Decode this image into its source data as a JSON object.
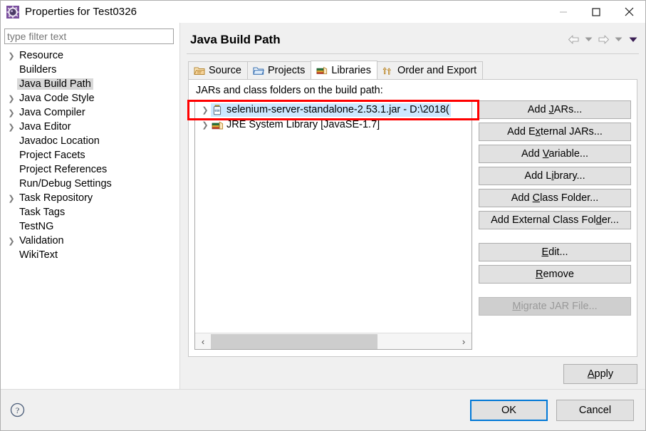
{
  "window": {
    "title": "Properties for Test0326",
    "icon": "properties-gear-icon",
    "minimize_label": "—",
    "maximize_label": "□",
    "close_label": "✕"
  },
  "sidebar": {
    "filter": {
      "value": "",
      "placeholder": "type filter text"
    },
    "items": [
      {
        "label": "Resource",
        "expandable": true,
        "selected": false
      },
      {
        "label": "Builders",
        "expandable": false,
        "selected": false
      },
      {
        "label": "Java Build Path",
        "expandable": false,
        "selected": true
      },
      {
        "label": "Java Code Style",
        "expandable": true,
        "selected": false
      },
      {
        "label": "Java Compiler",
        "expandable": true,
        "selected": false
      },
      {
        "label": "Java Editor",
        "expandable": true,
        "selected": false
      },
      {
        "label": "Javadoc Location",
        "expandable": false,
        "selected": false
      },
      {
        "label": "Project Facets",
        "expandable": false,
        "selected": false
      },
      {
        "label": "Project References",
        "expandable": false,
        "selected": false
      },
      {
        "label": "Run/Debug Settings",
        "expandable": false,
        "selected": false
      },
      {
        "label": "Task Repository",
        "expandable": true,
        "selected": false
      },
      {
        "label": "Task Tags",
        "expandable": false,
        "selected": false
      },
      {
        "label": "TestNG",
        "expandable": false,
        "selected": false
      },
      {
        "label": "Validation",
        "expandable": true,
        "selected": false
      },
      {
        "label": "WikiText",
        "expandable": false,
        "selected": false
      }
    ]
  },
  "page": {
    "title": "Java Build Path",
    "nav": {
      "back_icon": "back-arrow-icon",
      "back_menu_icon": "chevron-down-icon",
      "forward_icon": "forward-arrow-icon",
      "forward_menu_icon": "chevron-down-icon",
      "view_menu_icon": "view-menu-triangle-icon"
    }
  },
  "tabs": [
    {
      "label": "Source",
      "icon": "source-folder-icon",
      "active": false
    },
    {
      "label": "Projects",
      "icon": "projects-folder-icon",
      "active": false
    },
    {
      "label": "Libraries",
      "icon": "libraries-books-icon",
      "active": true
    },
    {
      "label": "Order and Export",
      "icon": "order-arrows-icon",
      "active": false
    }
  ],
  "libraries_tab": {
    "caption": "JARs and class folders on the build path:",
    "entries": [
      {
        "label": "selenium-server-standalone-2.53.1.jar - D:\\2018(",
        "icon": "jar-icon",
        "expandable": true,
        "selected": true,
        "annotated": true
      },
      {
        "label": "JRE System Library [JavaSE-1.7]",
        "icon": "jre-library-icon",
        "expandable": true,
        "selected": false,
        "annotated": false
      }
    ],
    "scrollbar": {
      "left_arrow": "‹",
      "right_arrow": "›",
      "thumb_percent": 68
    },
    "buttons": [
      {
        "label": "Add JARs...",
        "mnemonic_index": 4,
        "disabled": false,
        "gap_before": false
      },
      {
        "label": "Add External JARs...",
        "mnemonic_index": 5,
        "disabled": false,
        "gap_before": false
      },
      {
        "label": "Add Variable...",
        "mnemonic_index": 4,
        "disabled": false,
        "gap_before": false
      },
      {
        "label": "Add Library...",
        "mnemonic_index": 5,
        "disabled": false,
        "gap_before": false
      },
      {
        "label": "Add Class Folder...",
        "mnemonic_index": 4,
        "disabled": false,
        "gap_before": false
      },
      {
        "label": "Add External Class Folder...",
        "mnemonic_index": 21,
        "disabled": false,
        "gap_before": false
      },
      {
        "label": "Edit...",
        "mnemonic_index": 0,
        "disabled": false,
        "gap_before": true
      },
      {
        "label": "Remove",
        "mnemonic_index": 0,
        "disabled": false,
        "gap_before": false
      },
      {
        "label": "Migrate JAR File...",
        "mnemonic_index": 0,
        "disabled": true,
        "gap_before": true
      }
    ]
  },
  "apply": {
    "label": "Apply",
    "mnemonic_index": 0
  },
  "footer": {
    "help_icon": "help-question-icon",
    "ok_label": "OK",
    "cancel_label": "Cancel"
  },
  "colors": {
    "selection_blue": "#cde8ff",
    "annotation_red": "#ff0000",
    "default_button_focus": "#0078d7",
    "dialog_bg": "#f0f0f0"
  }
}
